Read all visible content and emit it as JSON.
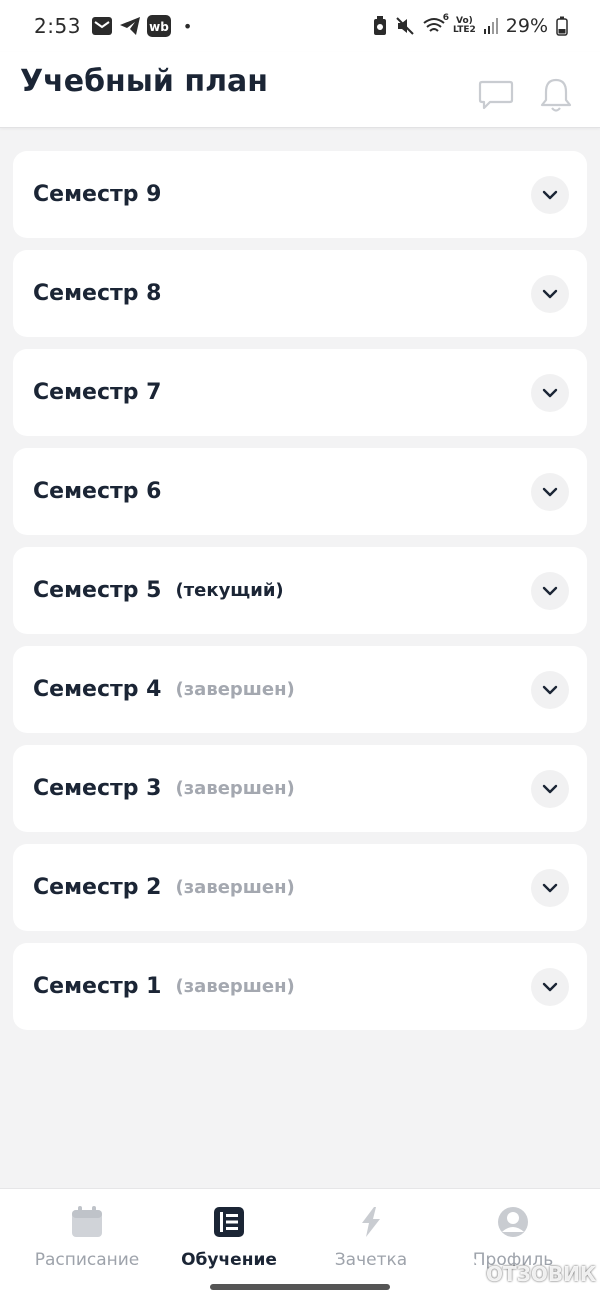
{
  "status_bar": {
    "time": "2:53",
    "dot": "•",
    "left_icons": [
      "mail-icon",
      "telegram-icon",
      "wb-app-icon"
    ],
    "wb_label": "wb",
    "network_top": "Vo)",
    "network_bottom": "LTE2",
    "wifi_label": "6",
    "battery_percent": "29%"
  },
  "header": {
    "title": "Учебный план",
    "icons": [
      "chat-icon",
      "bell-icon"
    ]
  },
  "semesters": [
    {
      "label": "Семестр 9",
      "status": ""
    },
    {
      "label": "Семестр 8",
      "status": ""
    },
    {
      "label": "Семестр 7",
      "status": ""
    },
    {
      "label": "Семестр 6",
      "status": ""
    },
    {
      "label": "Семестр 5",
      "status": "(текущий)"
    },
    {
      "label": "Семестр 4",
      "status": "(завершен)"
    },
    {
      "label": "Семестр 3",
      "status": "(завершен)"
    },
    {
      "label": "Семестр 2",
      "status": "(завершен)"
    },
    {
      "label": "Семестр 1",
      "status": "(завершен)"
    }
  ],
  "bottom_nav": {
    "items": [
      {
        "label": "Расписание",
        "icon": "calendar-icon",
        "active": false
      },
      {
        "label": "Обучение",
        "icon": "book-icon",
        "active": true
      },
      {
        "label": "Зачетка",
        "icon": "lightning-icon",
        "active": false
      },
      {
        "label": "Профиль",
        "icon": "profile-icon",
        "active": false
      }
    ]
  },
  "watermark": "ОТЗОВИК",
  "colors": {
    "background": "#f3f3f4",
    "card": "#ffffff",
    "text_primary": "#1b2535",
    "text_muted": "#a4a8b0",
    "nav_inactive": "#9ea3ab"
  }
}
